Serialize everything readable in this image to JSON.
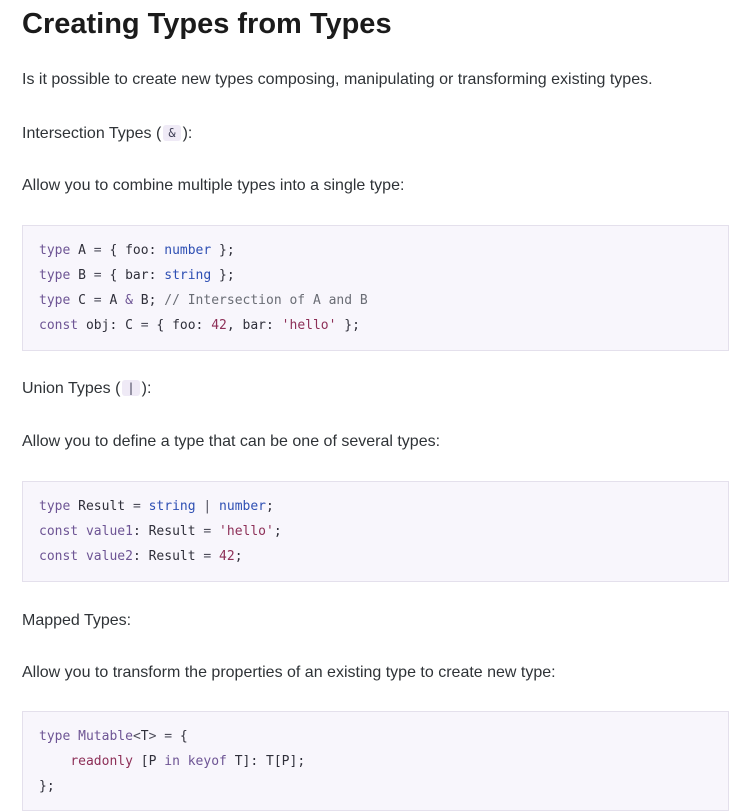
{
  "title": "Creating Types from Types",
  "intro": "Is it possible to create new types composing, manipulating or transforming existing types.",
  "sections": [
    {
      "heading_prefix": "Intersection Types (",
      "heading_code": "&",
      "heading_suffix": "):",
      "description": "Allow you to combine multiple types into a single type:",
      "code_lines": [
        "type A = { foo: number };",
        "type B = { bar: string };",
        "type C = A & B; // Intersection of A and B",
        "const obj: C = { foo: 42, bar: 'hello' };"
      ]
    },
    {
      "heading_prefix": "Union Types (",
      "heading_code": "|",
      "heading_suffix": "):",
      "description": "Allow you to define a type that can be one of several types:",
      "code_lines": [
        "type Result = string | number;",
        "const value1: Result = 'hello';",
        "const value2: Result = 42;"
      ]
    },
    {
      "heading_text": "Mapped Types:",
      "description": "Allow you to transform the properties of an existing type to create new type:",
      "code_lines": [
        "type Mutable<T> = {",
        "    readonly [P in keyof T]: T[P];",
        "};"
      ]
    }
  ],
  "colors": {
    "code_background": "#f8f6fc",
    "code_border": "#e4e0ec",
    "inline_code_background": "#efeaf6",
    "keyword": "#6d5494",
    "type": "#2e4fb3",
    "string": "#8d2f57",
    "comment": "#6a6d75"
  }
}
